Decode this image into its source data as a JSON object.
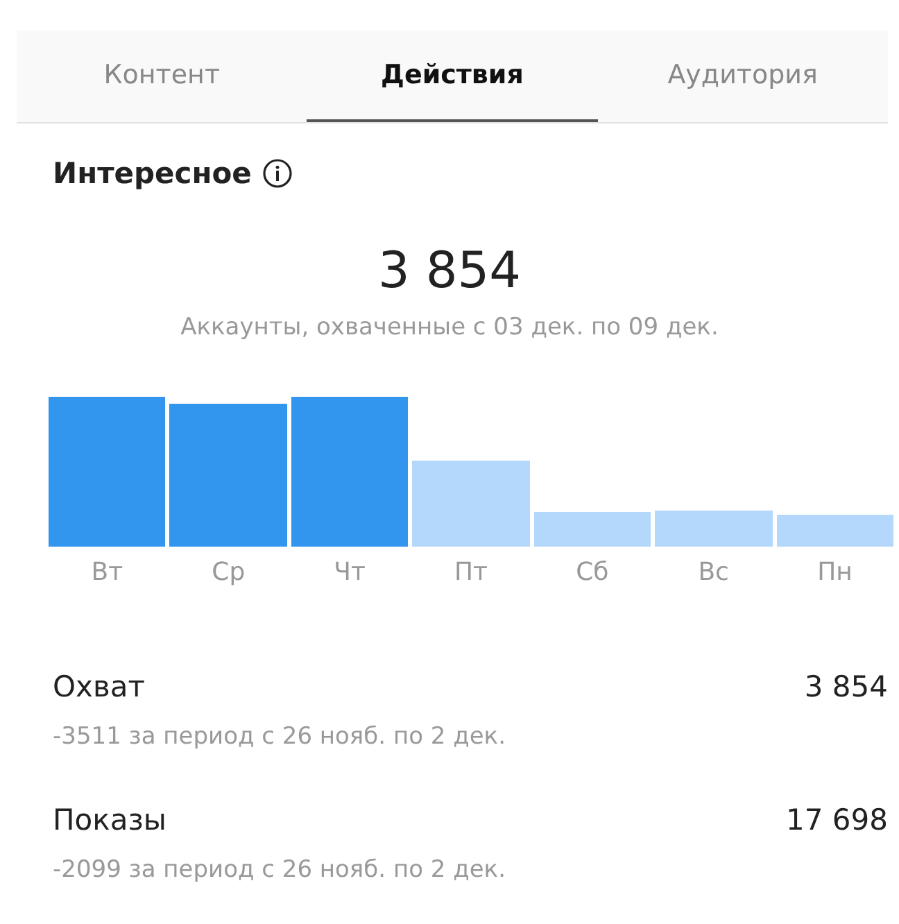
{
  "tabs": [
    {
      "label": "Контент",
      "selected": false
    },
    {
      "label": "Действия",
      "selected": true
    },
    {
      "label": "Аудитория",
      "selected": false
    }
  ],
  "section": {
    "title": "Интересное",
    "total": "3 854",
    "caption": "Аккаунты, охваченные с 03 дек. по 09 дек."
  },
  "days": [
    {
      "label": "Вт",
      "highlighted": true
    },
    {
      "label": "Ср",
      "highlighted": true
    },
    {
      "label": "Чт",
      "highlighted": true
    },
    {
      "label": "Пт",
      "highlighted": false
    },
    {
      "label": "Сб",
      "highlighted": false
    },
    {
      "label": "Вс",
      "highlighted": false
    },
    {
      "label": "Пн",
      "highlighted": false
    }
  ],
  "metrics": [
    {
      "name": "Охват",
      "value": "3 854",
      "change": "-3511 за период с 26 нояб. по 2 дек."
    },
    {
      "name": "Показы",
      "value": "17 698",
      "change": "-2099 за период с 26 нояб. по 2 дек."
    }
  ]
}
